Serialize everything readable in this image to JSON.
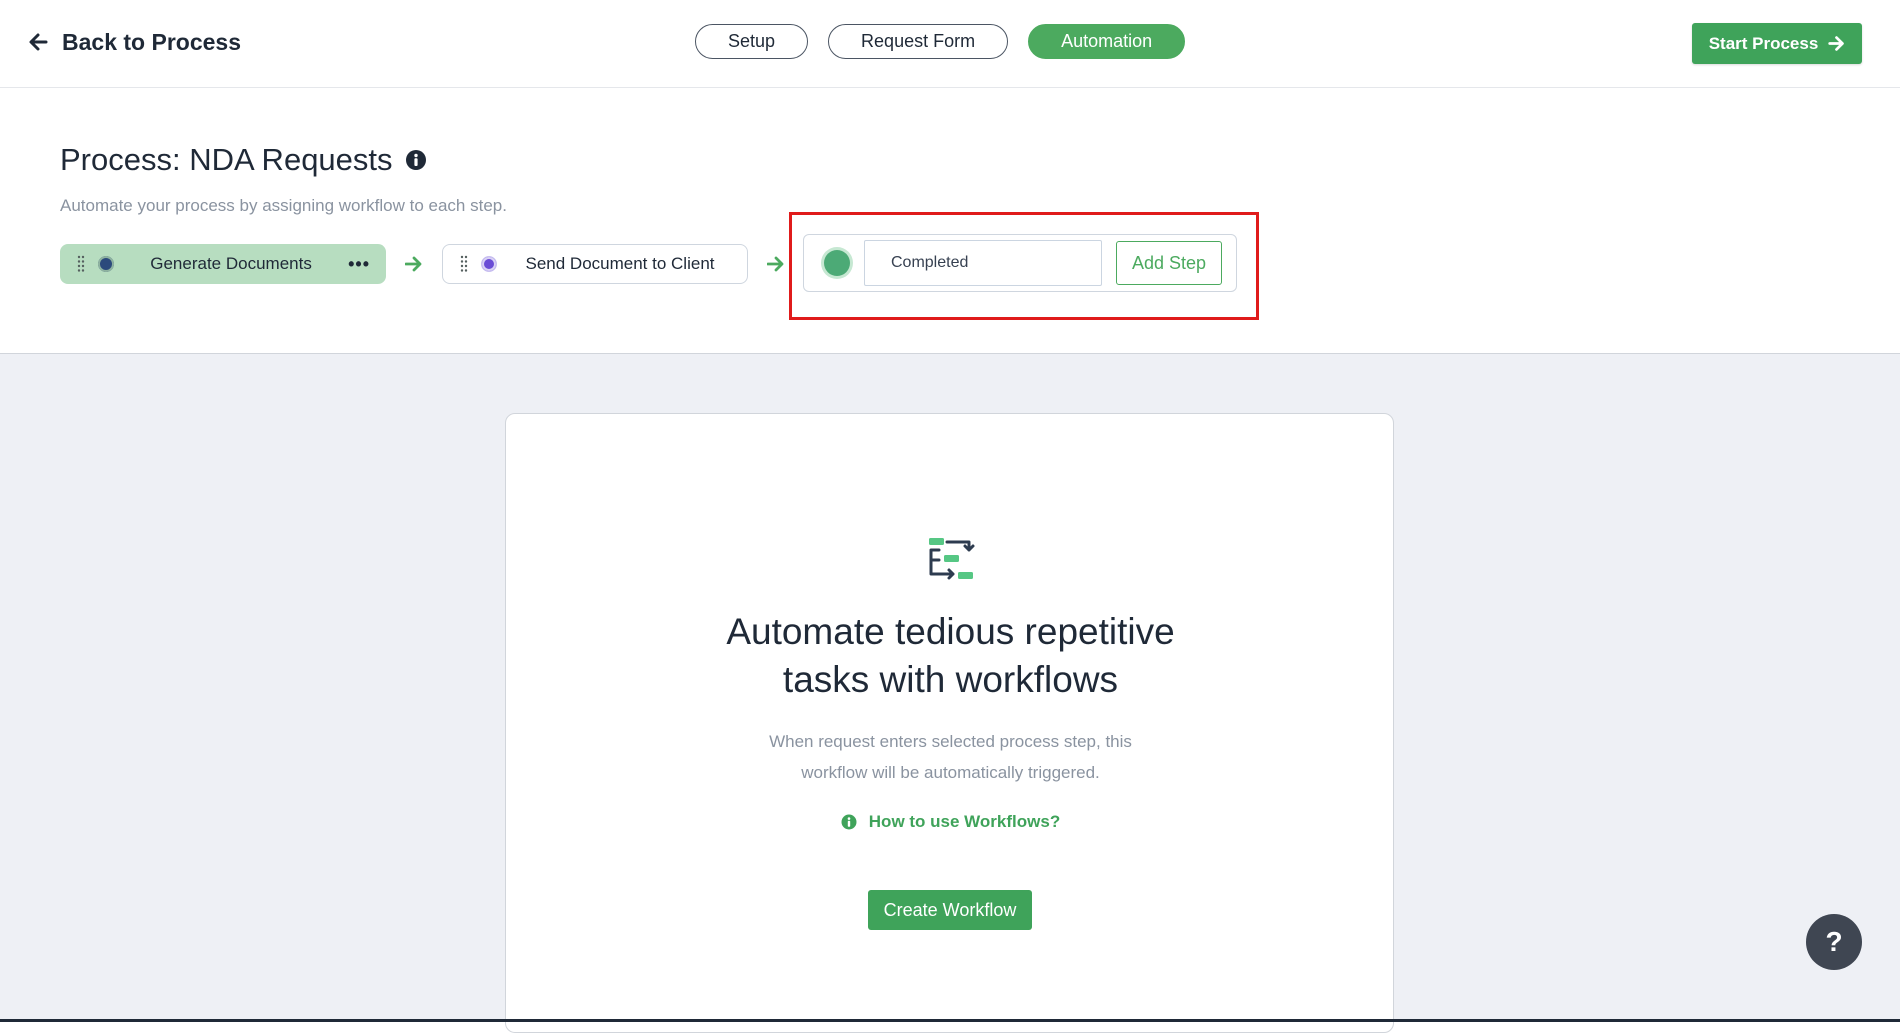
{
  "topbar": {
    "back_label": "Back to Process",
    "tabs": [
      {
        "label": "Setup",
        "active": false
      },
      {
        "label": "Request Form",
        "active": false
      },
      {
        "label": "Automation",
        "active": true
      }
    ],
    "start_label": "Start Process"
  },
  "process": {
    "title": "Process: NDA Requests",
    "subtitle": "Automate your process by assigning workflow to each step.",
    "steps": [
      {
        "label": "Generate Documents",
        "dot_color": "#2c4a7c"
      },
      {
        "label": "Send Document to Client",
        "dot_color": "#6a4cd6"
      }
    ],
    "new_step": {
      "value": "Completed",
      "add_label": "Add Step",
      "dot_color": "#4caa76"
    }
  },
  "workflow_card": {
    "title_line1": "Automate tedious repetitive",
    "title_line2": "tasks with workflows",
    "desc_line1": "When request enters selected process step, this",
    "desc_line2": "workflow will be automatically triggered.",
    "help_link": "How to use Workflows?",
    "create_label": "Create Workflow",
    "icon": "workflow-icon"
  },
  "help": {
    "label": "?"
  },
  "colors": {
    "brand_green": "#3fa35a",
    "active_tab": "#4caa5f",
    "highlight_red": "#e01b1b",
    "filled_step": "#b7ddc0"
  }
}
